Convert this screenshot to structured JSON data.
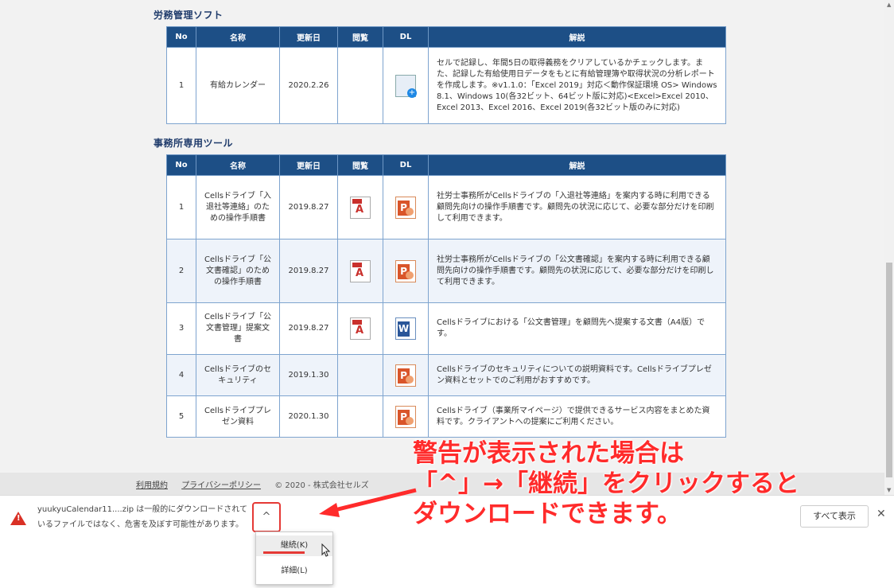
{
  "section1": {
    "title": "労務管理ソフト",
    "headers": [
      "No",
      "名称",
      "更新日",
      "閲覧",
      "DL",
      "解説"
    ],
    "rows": [
      {
        "no": "1",
        "name": "有給カレンダー",
        "date": "2020.2.26",
        "view_icon": "",
        "dl_icon": "calendar-file-icon",
        "desc": "セルで記録し、年間5日の取得義務をクリアしているかチェックします。また、記録した有給使用日データをもとに有給管理簿や取得状況の分析レポートを作成します。※v1.1.0：「Excel 2019」対応＜動作保証環境 OS> Windows 8.1、Windows 10(各32ビット、64ビット版に対応)<Excel>Excel 2010、Excel 2013、Excel 2016、Excel 2019(各32ビット版のみに対応)"
      }
    ]
  },
  "section2": {
    "title": "事務所専用ツール",
    "headers": [
      "No",
      "名称",
      "更新日",
      "閲覧",
      "DL",
      "解説"
    ],
    "rows": [
      {
        "no": "1",
        "name": "Cellsドライブ「入退社等連絡」のための操作手順書",
        "date": "2019.8.27",
        "view_icon": "pdf-icon",
        "dl_icon": "ppt-icon",
        "desc": "社労士事務所がCellsドライブの「入退社等連絡」を案内する時に利用できる顧問先向けの操作手順書です。顧問先の状況に応じて、必要な部分だけを印刷して利用できます。"
      },
      {
        "no": "2",
        "name": "Cellsドライブ「公文書確認」のための操作手順書",
        "date": "2019.8.27",
        "view_icon": "pdf-icon",
        "dl_icon": "ppt-icon",
        "desc": "社労士事務所がCellsドライブの「公文書確認」を案内する時に利用できる顧問先向けの操作手順書です。顧問先の状況に応じて、必要な部分だけを印刷して利用できます。"
      },
      {
        "no": "3",
        "name": "Cellsドライブ「公文書管理」提案文書",
        "date": "2019.8.27",
        "view_icon": "pdf-icon",
        "dl_icon": "word-icon",
        "desc": "Cellsドライブにおける「公文書管理」を顧問先へ提案する文書（A4版）です。"
      },
      {
        "no": "4",
        "name": "Cellsドライブのセキュリティ",
        "date": "2019.1.30",
        "view_icon": "",
        "dl_icon": "ppt-icon",
        "desc": "Cellsドライブのセキュリティについての説明資料です。Cellsドライブプレゼン資料とセットでのご利用がおすすめです。"
      },
      {
        "no": "5",
        "name": "Cellsドライブプレゼン資料",
        "date": "2020.1.30",
        "view_icon": "",
        "dl_icon": "ppt-icon",
        "desc": "Cellsドライブ（事業所マイページ）で提供できるサービス内容をまとめた資料です。クライアントへの提案にご利用ください。"
      }
    ]
  },
  "footer": {
    "terms": "利用規約",
    "privacy": "プライバシーポリシー",
    "copyright": "© 2020 - 株式会社セルズ"
  },
  "download_bar": {
    "warning_line1": "yuukyuCalendar11....zip は一般的にダウンロードされて",
    "warning_line2": "いるファイルではなく、危害を及ぼす可能性があります。",
    "chevron": "^",
    "show_all": "すべて表示",
    "close": "✕"
  },
  "menu": {
    "keep": "継続(K)",
    "details": "詳細(L)"
  },
  "annotation": {
    "line1": "警告が表示された場合は",
    "line2": "「^」→「継続」をクリックすると",
    "line3": "ダウンロードできます。"
  },
  "colors": {
    "header_bg": "#1d4f86",
    "accent_red": "#ff2b2b",
    "warning_red": "#d93025"
  }
}
